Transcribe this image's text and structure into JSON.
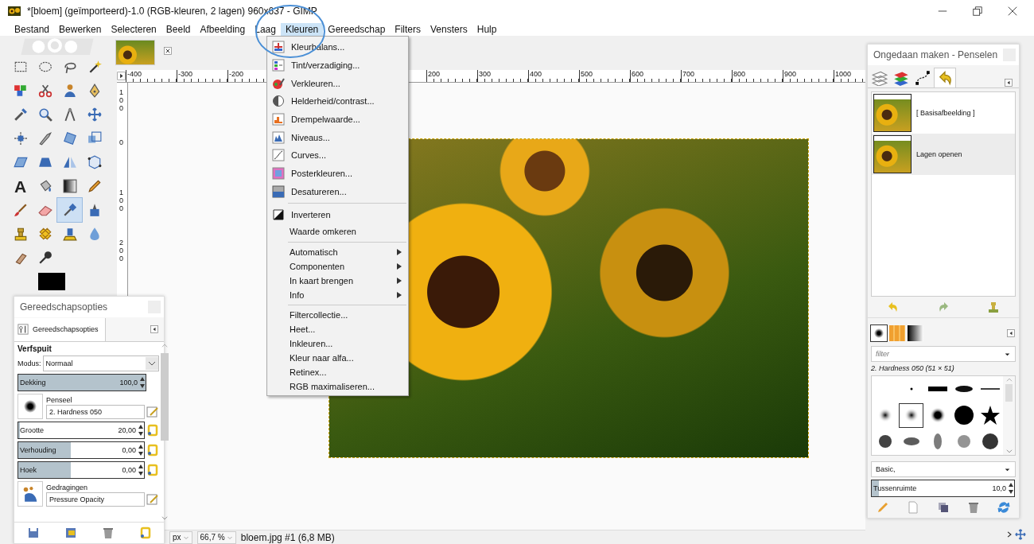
{
  "window": {
    "title": "*[bloem] (geïmporteerd)-1.0 (RGB-kleuren, 2 lagen) 960x637 - GIMP"
  },
  "menubar": [
    {
      "label": "Bestand",
      "selected": false
    },
    {
      "label": "Bewerken",
      "selected": false
    },
    {
      "label": "Selecteren",
      "selected": false
    },
    {
      "label": "Beeld",
      "selected": false
    },
    {
      "label": "Afbeelding",
      "selected": false
    },
    {
      "label": "Laag",
      "selected": false
    },
    {
      "label": "Kleuren",
      "selected": true
    },
    {
      "label": "Gereedschap",
      "selected": false
    },
    {
      "label": "Filters",
      "selected": false
    },
    {
      "label": "Vensters",
      "selected": false
    },
    {
      "label": "Hulp",
      "selected": false
    }
  ],
  "menu": [
    {
      "kind": "icon_item",
      "label": "Kleurbalans..."
    },
    {
      "kind": "icon_item",
      "label": "Tint/verzadiging..."
    },
    {
      "kind": "icon_item",
      "label": "Verkleuren..."
    },
    {
      "kind": "icon_item",
      "label": "Helderheid/contrast..."
    },
    {
      "kind": "icon_item",
      "label": "Drempelwaarde..."
    },
    {
      "kind": "icon_item",
      "label": "Niveaus..."
    },
    {
      "kind": "icon_item",
      "label": "Curves..."
    },
    {
      "kind": "icon_item",
      "label": "Posterkleuren..."
    },
    {
      "kind": "icon_item",
      "label": "Desatureren..."
    },
    {
      "kind": "separator"
    },
    {
      "kind": "icon_item",
      "label": "Inverteren"
    },
    {
      "kind": "item",
      "label": "Waarde omkeren"
    },
    {
      "kind": "separator"
    },
    {
      "kind": "submenu",
      "label": "Automatisch"
    },
    {
      "kind": "submenu",
      "label": "Componenten"
    },
    {
      "kind": "submenu",
      "label": "In kaart brengen"
    },
    {
      "kind": "submenu",
      "label": "Info"
    },
    {
      "kind": "separator"
    },
    {
      "kind": "item",
      "label": "Filtercollectie..."
    },
    {
      "kind": "item",
      "label": "Heet..."
    },
    {
      "kind": "item",
      "label": "Inkleuren..."
    },
    {
      "kind": "item",
      "label": "Kleur naar alfa..."
    },
    {
      "kind": "item",
      "label": "Retinex..."
    },
    {
      "kind": "item",
      "label": "RGB maximaliseren..."
    }
  ],
  "tools": [
    {
      "selected": false
    },
    {
      "selected": false
    },
    {
      "selected": false
    },
    {
      "selected": false
    },
    {
      "selected": false
    },
    {
      "selected": false
    },
    {
      "selected": false
    },
    {
      "selected": false
    },
    {
      "selected": false
    },
    {
      "selected": false
    },
    {
      "selected": false
    },
    {
      "selected": false
    },
    {
      "selected": false
    },
    {
      "selected": false
    },
    {
      "selected": false
    },
    {
      "selected": false
    },
    {
      "selected": false
    },
    {
      "selected": false
    },
    {
      "selected": false
    },
    {
      "selected": false
    },
    {
      "selected": false,
      "glyph": "A"
    },
    {
      "selected": false
    },
    {
      "selected": false
    },
    {
      "selected": false
    },
    {
      "selected": false
    },
    {
      "selected": false
    },
    {
      "selected": true
    },
    {
      "selected": false
    },
    {
      "selected": false
    },
    {
      "selected": false
    },
    {
      "selected": false
    },
    {
      "selected": false
    },
    {
      "selected": false
    },
    {
      "selected": false
    }
  ],
  "tool_options": {
    "title": "Gereedschapsopties",
    "tab": "Gereedschapsopties",
    "tool_name": "Verfspuit",
    "mode_label": "Modus:",
    "mode": "Normaal",
    "opacity": {
      "label": "Dekking",
      "reading": "100,0",
      "level": 1
    },
    "brush": {
      "label": "Penseel",
      "value": "2. Hardness 050"
    },
    "size": {
      "label": "Grootte",
      "reading": "20,00",
      "level": 0.01
    },
    "aspect": {
      "label": "Verhouding",
      "reading": "0,00",
      "level": 0.42
    },
    "angle": {
      "label": "Hoek",
      "reading": "0,00",
      "level": 0.42
    },
    "dynamics": {
      "label": "Gedragingen",
      "value": "Pressure Opacity"
    }
  },
  "ruler": {
    "left_labels": [
      "-400",
      "-300",
      "-200"
    ],
    "right_labels": [
      "200",
      "300",
      "400",
      "500",
      "600",
      "700",
      "800",
      "900",
      "1000"
    ],
    "vertical_labels": [
      "100",
      "0",
      "100",
      "200"
    ]
  },
  "status_bar": {
    "unit": "px",
    "zoom": "66,7 %",
    "file": "bloem.jpg #1 (6,8 MB)"
  },
  "dock": {
    "title": "Ongedaan maken - Penselen",
    "tabs": [
      {
        "selected": false
      },
      {
        "selected": false
      },
      {
        "selected": false
      },
      {
        "selected": true
      }
    ],
    "history": [
      {
        "label": "[ Basisafbeelding ]",
        "selected": false
      },
      {
        "label": "Lagen openen",
        "selected": true
      }
    ],
    "brush_tabs": [
      {
        "selected": true
      },
      {
        "selected": false
      },
      {
        "selected": false
      }
    ],
    "filter": {
      "placeholder": "filter"
    },
    "brush_name": "2. Hardness 050 (51 × 51)",
    "brushes": [
      {
        "selected": false
      },
      {
        "selected": false
      },
      {
        "selected": false
      },
      {
        "selected": false
      },
      {
        "selected": false
      },
      {
        "selected": true
      },
      {
        "selected": false
      },
      {
        "selected": false
      },
      {
        "selected": false
      },
      {
        "selected": false
      },
      {
        "selected": false
      },
      {
        "selected": false
      },
      {
        "selected": false
      },
      {
        "selected": false
      }
    ],
    "tag": "Basic,",
    "spacing": {
      "label": "Tussenruimte",
      "reading": "10,0",
      "level": 0.05
    }
  }
}
